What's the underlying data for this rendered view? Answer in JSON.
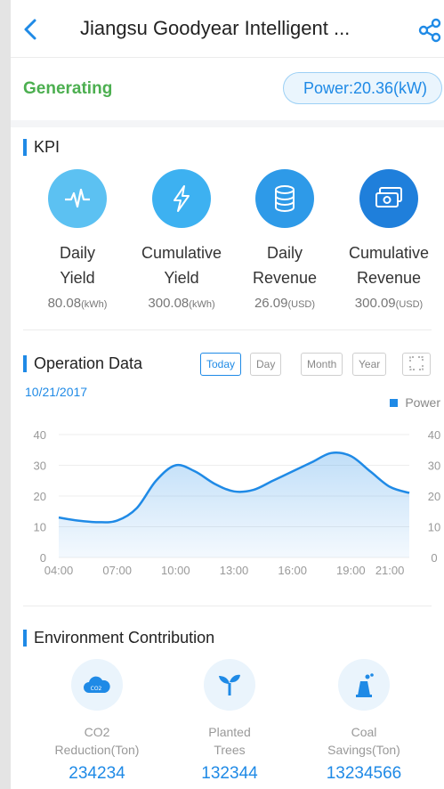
{
  "header": {
    "title": "Jiangsu Goodyear Intelligent ...",
    "back_icon": "chevron-left-icon",
    "share_icon": "share-icon"
  },
  "status": {
    "state": "Generating",
    "power": "Power:20.36(kW)"
  },
  "kpi": {
    "title": "KPI",
    "items": [
      {
        "line1": "Daily",
        "line2": "Yield",
        "value": "80.08",
        "unit": "(kWh)",
        "icon": "pulse-icon",
        "color": "#5cc1f2"
      },
      {
        "line1": "Cumulative",
        "line2": "Yield",
        "value": "300.08",
        "unit": "(kWh)",
        "icon": "lightning-icon",
        "color": "#3db1f1"
      },
      {
        "line1": "Daily",
        "line2": "Revenue",
        "value": "26.09",
        "unit": "(USD)",
        "icon": "coins-icon",
        "color": "#2e9ae8"
      },
      {
        "line1": "Cumulative",
        "line2": "Revenue",
        "value": "300.09",
        "unit": "(USD)",
        "icon": "banknote-icon",
        "color": "#1f7fdb"
      }
    ]
  },
  "operation": {
    "title": "Operation Data",
    "ranges": [
      "Today",
      "Day",
      "Month",
      "Year"
    ],
    "active_range": "Today",
    "fullscreen_icon": "fullscreen-icon",
    "date": "10/21/2017",
    "legend": "Power"
  },
  "chart_data": {
    "type": "area",
    "x": [
      "04:00",
      "05:00",
      "06:00",
      "07:00",
      "08:00",
      "09:00",
      "10:00",
      "11:00",
      "12:00",
      "13:00",
      "14:00",
      "15:00",
      "16:00",
      "17:00",
      "18:00",
      "19:00",
      "20:00",
      "21:00",
      "22:00"
    ],
    "x_ticks": [
      "04:00",
      "07:00",
      "10:00",
      "13:00",
      "16:00",
      "19:00",
      "21:00"
    ],
    "series": [
      {
        "name": "Power",
        "values": [
          13,
          12,
          11.5,
          12,
          16,
          25,
          30,
          28,
          24,
          21.5,
          22,
          25,
          28,
          31,
          34,
          33,
          28,
          23,
          21
        ]
      }
    ],
    "ylim": [
      0,
      40
    ],
    "y_ticks": [
      0,
      10,
      20,
      30,
      40
    ],
    "grid": true,
    "legend_position": "top-right",
    "color": "#1f8ae6"
  },
  "environment": {
    "title": "Environment Contribution",
    "items": [
      {
        "line1": "CO2",
        "line2": "Reduction(Ton)",
        "value": "234234",
        "icon": "co2-cloud-icon"
      },
      {
        "line1": "Planted",
        "line2": "Trees",
        "value": "132344",
        "icon": "sprout-icon"
      },
      {
        "line1": "Coal",
        "line2": "Savings(Ton)",
        "value": "13234566",
        "icon": "factory-icon"
      }
    ]
  }
}
